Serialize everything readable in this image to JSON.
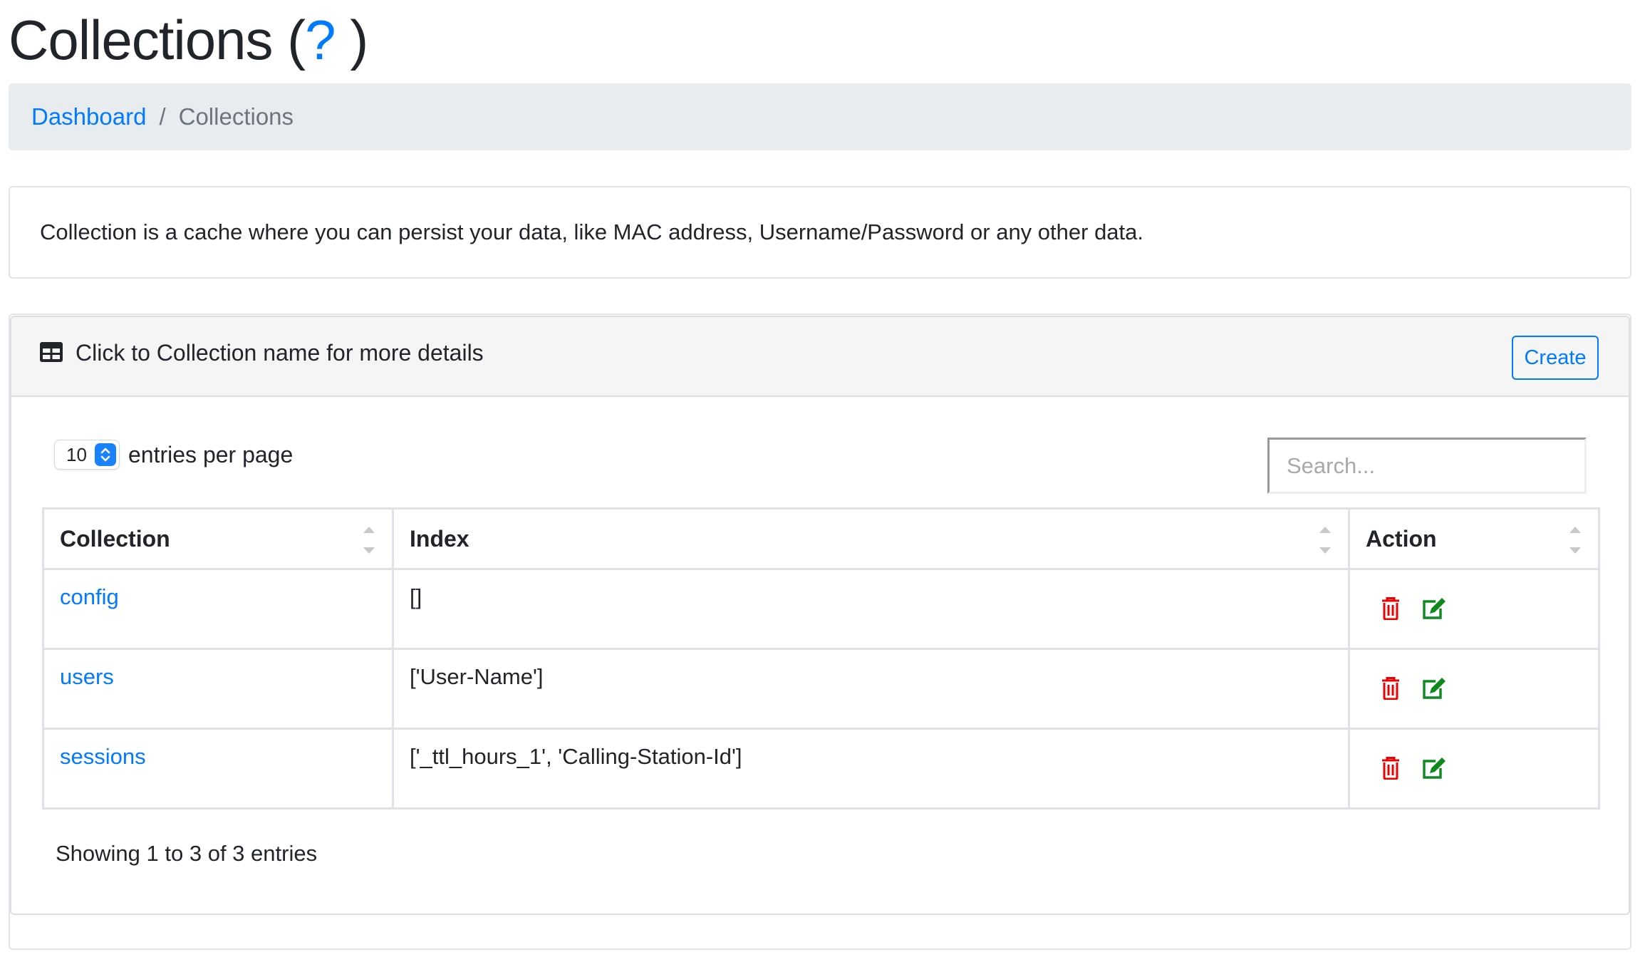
{
  "page": {
    "title": "Collections (",
    "help_mark": "?",
    "title_close": " )"
  },
  "breadcrumb": {
    "items": [
      {
        "label": "Dashboard",
        "link": true
      },
      {
        "label": "Collections",
        "link": false
      }
    ],
    "separator": "/"
  },
  "description": "Collection is a cache where you can persist your data, like MAC address, Username/Password or any other data.",
  "card": {
    "header_icon": "table-icon",
    "header_text": "Click to Collection name for more details",
    "create_label": "Create"
  },
  "controls": {
    "per_page_value": "10",
    "per_page_label": "entries per page",
    "search_placeholder": "Search...",
    "search_value": ""
  },
  "table": {
    "columns": [
      "Collection",
      "Index",
      "Action"
    ],
    "rows": [
      {
        "collection": "config",
        "index": "[]"
      },
      {
        "collection": "users",
        "index": "['User-Name']"
      },
      {
        "collection": "sessions",
        "index": "['_ttl_hours_1', 'Calling-Station-Id']"
      }
    ],
    "action_icons": [
      "trash-icon",
      "edit-icon"
    ]
  },
  "footer": {
    "info": "Showing 1 to 3 of 3 entries"
  },
  "colors": {
    "primary": "#007bff",
    "delete": "#ee0000",
    "edit": "#0c8a1c"
  }
}
